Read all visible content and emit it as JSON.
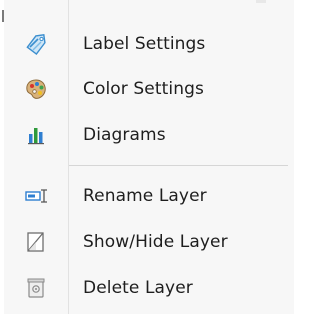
{
  "menu": {
    "items": [
      {
        "label": "Label Settings",
        "icon": "label-settings-icon"
      },
      {
        "label": "Color Settings",
        "icon": "color-palette-icon"
      },
      {
        "label": "Diagrams",
        "icon": "bar-chart-icon"
      },
      {
        "label": "Rename Layer",
        "icon": "rename-icon"
      },
      {
        "label": "Show/Hide Layer",
        "icon": "visibility-toggle-icon"
      },
      {
        "label": "Delete Layer",
        "icon": "trash-icon"
      }
    ]
  }
}
